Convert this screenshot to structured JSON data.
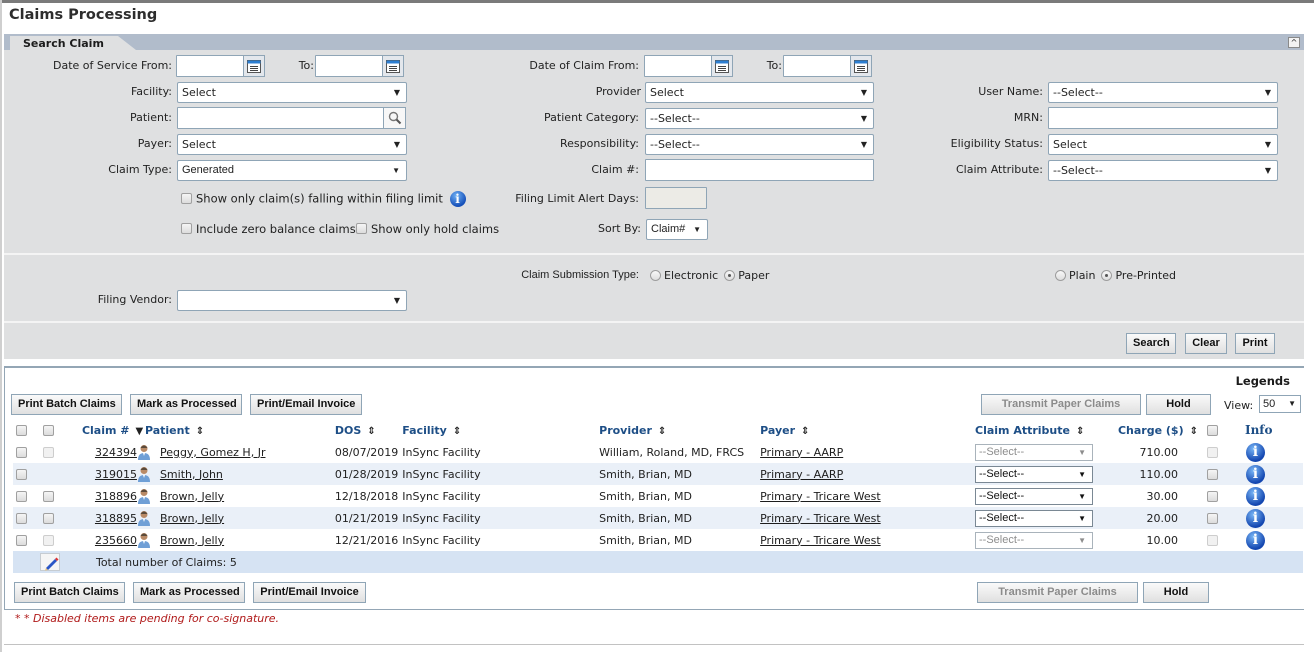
{
  "page": {
    "title": "Claims Processing"
  },
  "search_panel": {
    "tab_label": "Search Claim",
    "collapse_icon": "chevron-up-icon",
    "fields": {
      "dos_from": {
        "label": "Date of Service From:",
        "value": ""
      },
      "dos_to": {
        "label": "To:",
        "value": ""
      },
      "doc_from": {
        "label": "Date of Claim From:",
        "value": ""
      },
      "doc_to": {
        "label": "To:",
        "value": ""
      },
      "facility": {
        "label": "Facility:",
        "value": "Select"
      },
      "provider": {
        "label": "Provider",
        "value": "Select"
      },
      "user_name": {
        "label": "User Name:",
        "value": "--Select--"
      },
      "patient": {
        "label": "Patient:",
        "value": ""
      },
      "patient_category": {
        "label": "Patient Category:",
        "value": "--Select--"
      },
      "mrn": {
        "label": "MRN:",
        "value": ""
      },
      "payer": {
        "label": "Payer:",
        "value": "Select"
      },
      "responsibility": {
        "label": "Responsibility:",
        "value": "--Select--"
      },
      "eligibility_status": {
        "label": "Eligibility Status:",
        "value": "Select"
      },
      "claim_type": {
        "label": "Claim Type:",
        "value": "Generated"
      },
      "claim_number": {
        "label": "Claim #:",
        "value": ""
      },
      "claim_attribute": {
        "label": "Claim Attribute:",
        "value": "--Select--"
      },
      "filing_limit_days": {
        "label": "Filing Limit Alert Days:",
        "value": ""
      },
      "sort_by": {
        "label": "Sort By:",
        "value": "Claim#"
      },
      "filing_vendor": {
        "label": "Filing Vendor:",
        "value": ""
      }
    },
    "checkboxes": {
      "filing_limit": {
        "label": "Show only claim(s) falling within filing limit",
        "checked": false
      },
      "zero_balance": {
        "label": "Include zero balance claims",
        "checked": false
      },
      "hold_only": {
        "label": "Show only hold claims",
        "checked": false
      }
    },
    "submission": {
      "label": "Claim Submission Type:",
      "options": [
        "Electronic",
        "Paper"
      ],
      "selected": "Paper"
    },
    "print_format": {
      "options": [
        "Plain",
        "Pre-Printed"
      ],
      "selected": "Pre-Printed"
    },
    "buttons": {
      "search": "Search",
      "clear": "Clear",
      "print": "Print"
    }
  },
  "results": {
    "legends_label": "Legends",
    "view_label": "View:",
    "view_value": "50",
    "buttons": {
      "print_batch": "Print Batch Claims",
      "mark_processed": "Mark as Processed",
      "print_email_invoice": "Print/Email Invoice",
      "transmit_paper": "Transmit Paper Claims",
      "hold": "Hold"
    },
    "columns": {
      "claim": "Claim #",
      "patient": "Patient",
      "dos": "DOS",
      "facility": "Facility",
      "provider": "Provider",
      "payer": "Payer",
      "claim_attribute": "Claim Attribute",
      "charge": "Charge ($)",
      "info": "Info"
    },
    "rows": [
      {
        "claim": "324394",
        "patient": "Peggy, Gomez H, Jr",
        "dos": "08/07/2019",
        "facility": "InSync Facility",
        "provider": "William, Roland, MD, FRCS",
        "payer": "Primary - AARP",
        "claim_attribute": "--Select--",
        "charge": "710.00",
        "disabled": true
      },
      {
        "claim": "319015",
        "patient": "Smith, John",
        "dos": "01/28/2019",
        "facility": "InSync Facility",
        "provider": "Smith, Brian, MD",
        "payer": "Primary - AARP",
        "claim_attribute": "--Select--",
        "charge": "110.00",
        "disabled": false
      },
      {
        "claim": "318896",
        "patient": "Brown, Jelly",
        "dos": "12/18/2018",
        "facility": "InSync Facility",
        "provider": "Smith, Brian, MD",
        "payer": "Primary - Tricare West",
        "claim_attribute": "--Select--",
        "charge": "30.00",
        "disabled": false
      },
      {
        "claim": "318895",
        "patient": "Brown, Jelly",
        "dos": "01/21/2019",
        "facility": "InSync Facility",
        "provider": "Smith, Brian, MD",
        "payer": "Primary - Tricare West",
        "claim_attribute": "--Select--",
        "charge": "20.00",
        "disabled": false
      },
      {
        "claim": "235660",
        "patient": "Brown, Jelly",
        "dos": "12/21/2016",
        "facility": "InSync Facility",
        "provider": "Smith, Brian, MD",
        "payer": "Primary - Tricare West",
        "claim_attribute": "--Select--",
        "charge": "10.00",
        "disabled": true
      }
    ],
    "total_label": "Total number of Claims: 5"
  },
  "footer": {
    "note_marker": "* *",
    "note": "Disabled items are pending for co-signature."
  },
  "colors": {
    "header_blue": "#1d4e86",
    "panel_bg": "#dfe0e1",
    "panel_header": "#b1bccb",
    "alt_row": "#eaf0f8",
    "note_red": "#b01a1a"
  }
}
